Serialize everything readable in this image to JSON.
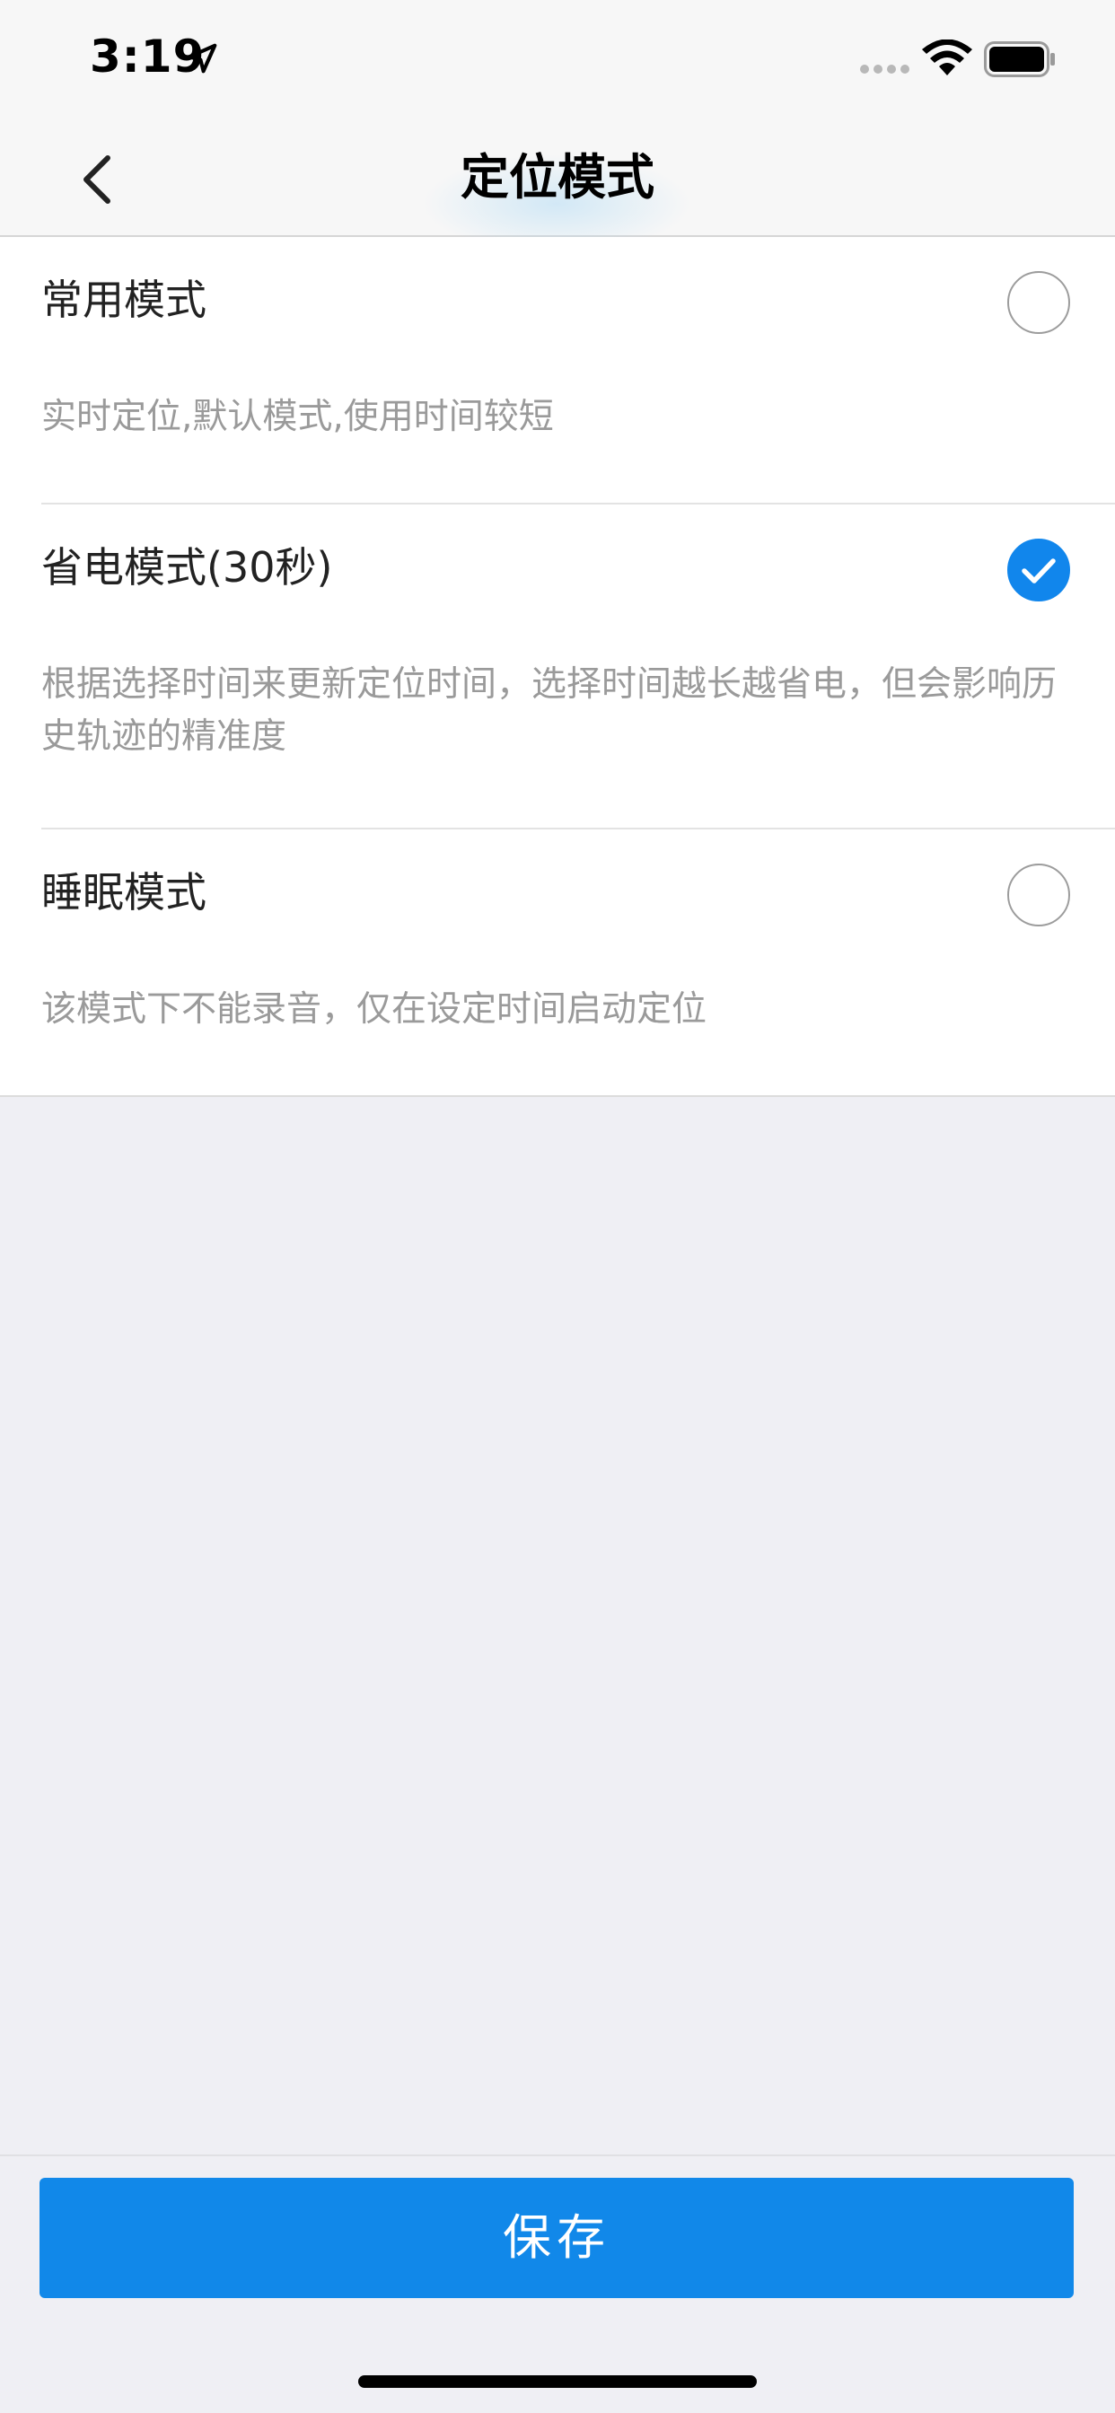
{
  "status_bar": {
    "time": "3:19",
    "icons": [
      "location-arrow-icon",
      "signal-dots-icon",
      "wifi-icon",
      "battery-icon"
    ]
  },
  "nav": {
    "title": "定位模式",
    "back_icon": "chevron-left-icon"
  },
  "modes": [
    {
      "title": "常用模式",
      "description": "实时定位,默认模式,使用时间较短",
      "selected": false
    },
    {
      "title": "省电模式(30秒)",
      "description": "根据选择时间来更新定位时间，选择时间越长越省电，但会影响历史轨迹的精准度",
      "selected": true
    },
    {
      "title": "睡眠模式",
      "description": "该模式下不能录音，仅在设定时间启动定位",
      "selected": false
    }
  ],
  "footer": {
    "save_label": "保存"
  },
  "colors": {
    "accent": "#1188e9",
    "radio_selected": "#1186ec",
    "background": "#efeff4",
    "description_text": "#9a9a9a"
  }
}
